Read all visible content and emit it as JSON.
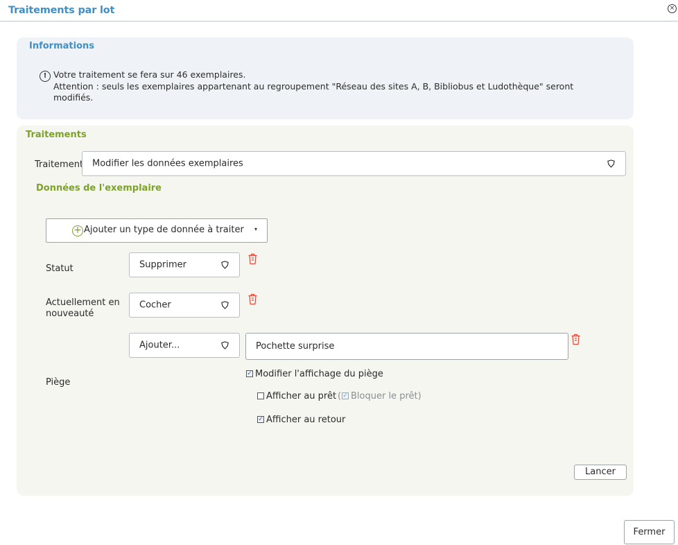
{
  "dialog": {
    "title": "Traitements par lot",
    "close_glyph": "×"
  },
  "info": {
    "heading": "Informations",
    "icon_glyph": "!",
    "line1": "Votre traitement se fera sur 46 exemplaires.",
    "line2": "Attention : seuls les exemplaires appartenant au regroupement \"Réseau des sites A, B, Bibliobus et Ludothèque\" seront modifiés."
  },
  "treatments": {
    "heading": "Traitements",
    "treatment_label": "Traitement",
    "treatment_value": "Modifier les données exemplaires",
    "sub_heading": "Données de l'exemplaire",
    "add_button_label": "Ajouter un type de donnée à traiter",
    "add_icon_glyph": "+",
    "caret_glyph": "▾",
    "rows": {
      "statut": {
        "label": "Statut",
        "value": "Supprimer"
      },
      "nouveaute": {
        "label_line1": "Actuellement en",
        "label_line2": "nouveauté",
        "value": "Cocher"
      },
      "piege": {
        "label": "Piège",
        "action_value": "Ajouter...",
        "text_value": "Pochette surprise",
        "options": {
          "modify_display": {
            "label": "Modifier l'affichage du piège",
            "checked": true
          },
          "show_on_loan": {
            "label": "Afficher au prêt",
            "checked": false
          },
          "block_loan": {
            "prefix": "(",
            "label": "Bloquer le prêt)",
            "checked": true,
            "disabled": true
          },
          "show_on_return": {
            "label": "Afficher au retour",
            "checked": true
          }
        }
      }
    },
    "launch_button": "Lancer"
  },
  "footer": {
    "close_button": "Fermer"
  },
  "colors": {
    "blue_heading": "#3f8fc8",
    "green_heading": "#7da22a",
    "trash_red": "#e0493a"
  },
  "icons": {
    "close": "close-icon",
    "info": "info-icon",
    "add": "plus-circle-icon",
    "dropdown": "shield-chevron-icon",
    "delete": "trash-icon"
  }
}
